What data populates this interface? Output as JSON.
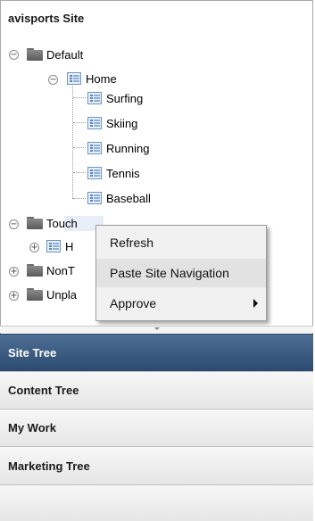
{
  "site": {
    "title": "avisports Site"
  },
  "tree": {
    "default": {
      "label": "Default",
      "toggle": "−"
    },
    "home": {
      "label": "Home",
      "toggle": "−"
    },
    "children": [
      "Surfing",
      "Skiing",
      "Running",
      "Tennis",
      "Baseball"
    ],
    "touch": {
      "label": "Touch",
      "toggle": "−"
    },
    "touch_child": {
      "label": "H",
      "toggle": "+"
    },
    "nont": {
      "label": "NonT",
      "toggle": "+"
    },
    "unpl": {
      "label": "Unpla",
      "toggle": "+"
    }
  },
  "context_menu": {
    "items": [
      {
        "label": "Refresh"
      },
      {
        "label": "Paste Site Navigation"
      },
      {
        "label": "Approve"
      }
    ]
  },
  "panels": {
    "site_tree": "Site Tree",
    "content_tree": "Content Tree",
    "my_work": "My Work",
    "marketing_tree": "Marketing Tree"
  }
}
